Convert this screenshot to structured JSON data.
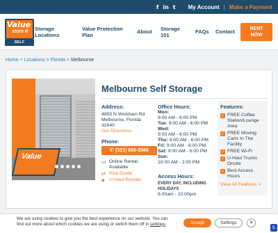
{
  "topbar": {
    "social": [
      "f",
      "in",
      "t"
    ],
    "account": "My Account",
    "separator": "|",
    "payment": "Make a Payment"
  },
  "logo": {
    "line1": "Value",
    "line2": "store it",
    "band": "SELF STORAGE"
  },
  "nav": {
    "storage": "Storage Locations",
    "protection": "Value Protection Plan",
    "about": "About",
    "storage101": "Storage 101",
    "faqs": "FAQs",
    "contact": "Contact",
    "rent": "RENT NOW"
  },
  "breadcrumb": {
    "home": "Home",
    "locations": "Locations",
    "state": "Florida",
    "current": "Melbourne",
    "sep": ">"
  },
  "location": {
    "title": "Melbourne Self Storage",
    "address_heading": "Address:",
    "address": [
      "4855 N Wickham Rd",
      "Melbourne, Florida",
      "32940"
    ],
    "directions": "Get Directions",
    "phone_heading": "Phone:",
    "phone": "(321) 655-5566",
    "services": [
      {
        "icon": "laptop-icon",
        "label": "Online Rental Available"
      },
      {
        "icon": "ruler-icon",
        "label": "Size Guide"
      },
      {
        "icon": "truck-icon",
        "label": "U-Haul Rentals"
      }
    ]
  },
  "hours": {
    "heading": "Office Hours:",
    "days": [
      {
        "day": "Mon:",
        "time": "9:00 AM - 6:00 PM",
        "inline": false
      },
      {
        "day": "Tue:",
        "time": "9:00 AM - 6:00 PM",
        "inline": true
      },
      {
        "day": "Wed:",
        "time": "9:00 AM - 6:00 PM",
        "inline": false
      },
      {
        "day": "Thu:",
        "time": "9:00 AM - 6:00 PM",
        "inline": true
      },
      {
        "day": "Fri:",
        "time": "9:00 AM - 6:00 PM",
        "inline": true
      },
      {
        "day": "Sat:",
        "time": "9:00 AM - 6:00 PM",
        "inline": true
      },
      {
        "day": "Sun:",
        "time": "10:00 AM - 2:00 PM",
        "inline": false
      }
    ],
    "access_heading": "Access Hours:",
    "access_days": "EVERY DAY, INCLUDING HOLIDAYS",
    "access_time": "6:00am - 10:00pm"
  },
  "features": {
    "heading": "Features:",
    "items": [
      "FREE Coffee Station/Lounge Area",
      "FREE Moving Carts In The Facility",
      "FREE Wi-Fi",
      "U-Haul Trucks Onsite",
      "Best Access Hours"
    ],
    "view_all": "View All Features >"
  },
  "cookie": {
    "message": "We are using cookies to give you the best experience on our website. You can find out more about which cookies we are using or switch them off in",
    "link": "settings",
    "end": ".",
    "accept": "Accept",
    "settings": "Settings",
    "close": "✕"
  },
  "colors": {
    "navy": "#1e4b6b",
    "orange": "#f47a20",
    "link": "#2b7fb8"
  }
}
